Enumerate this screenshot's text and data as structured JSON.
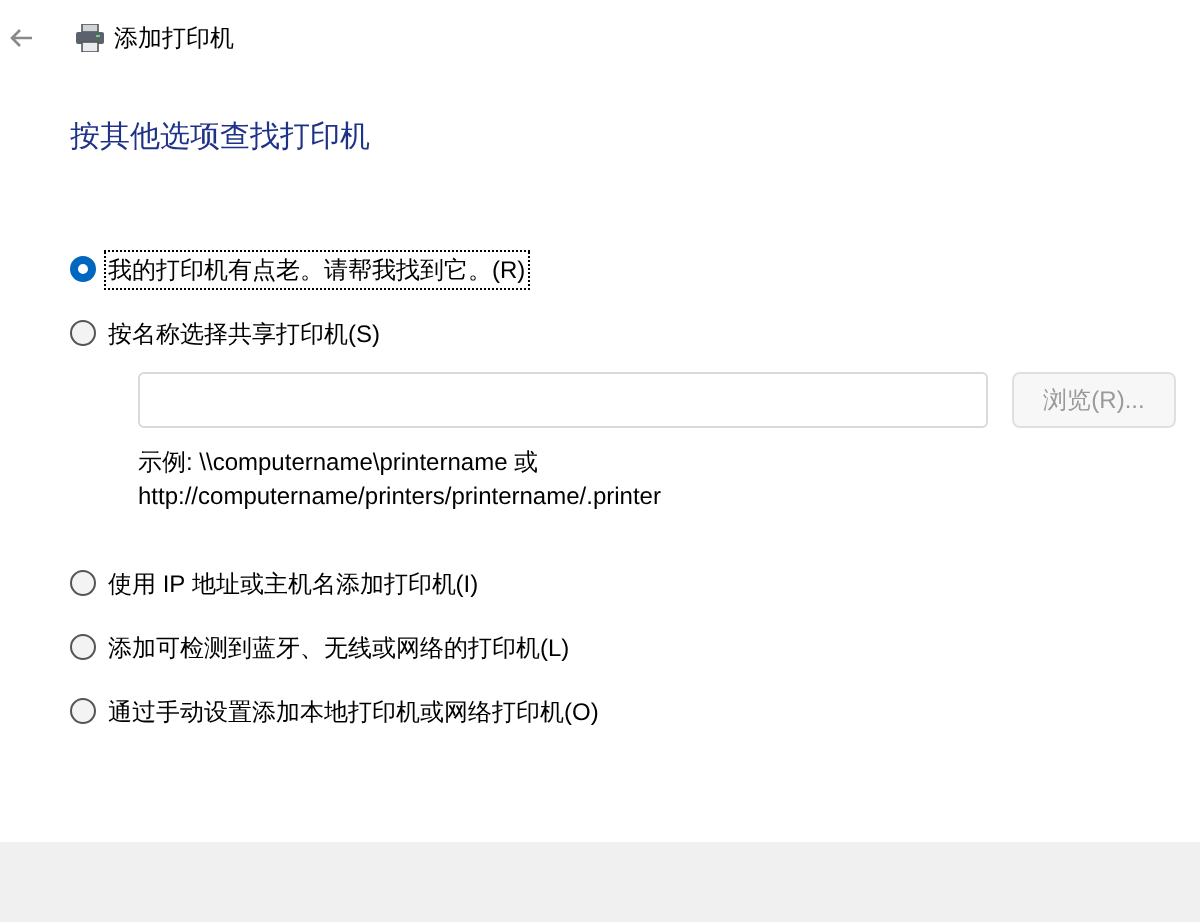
{
  "window": {
    "title": "添加打印机"
  },
  "heading": "按其他选项查找打印机",
  "options": [
    {
      "label": "我的打印机有点老。请帮我找到它。(R)",
      "selected": true
    },
    {
      "label": "按名称选择共享打印机(S)",
      "selected": false,
      "kind": "share"
    },
    {
      "label": "使用 IP 地址或主机名添加打印机(I)",
      "selected": false
    },
    {
      "label": "添加可检测到蓝牙、无线或网络的打印机(L)",
      "selected": false
    },
    {
      "label": "通过手动设置添加本地打印机或网络打印机(O)",
      "selected": false
    }
  ],
  "share": {
    "browse_button": {
      "label": "浏览(R)...",
      "disabled": true
    },
    "example_lines": [
      "示例: \\\\computername\\printername 或",
      "http://computername/printers/printername/.printer"
    ]
  }
}
